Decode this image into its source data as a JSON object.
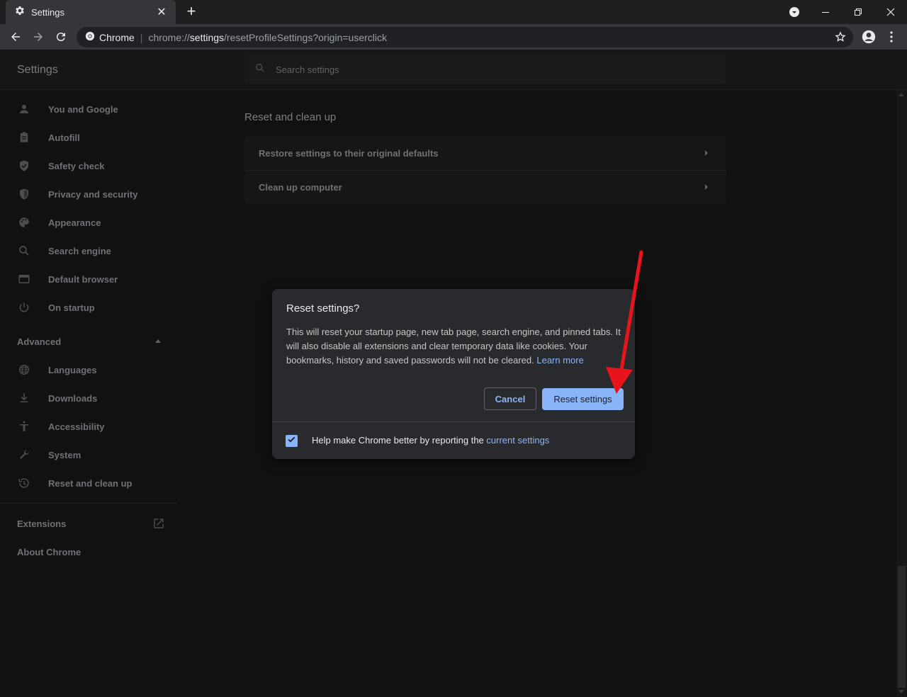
{
  "browser": {
    "tab_title": "Settings",
    "omnibox": {
      "site_label": "Chrome",
      "scheme": "chrome://",
      "host": "settings",
      "path": "/resetProfileSettings?origin=userclick"
    }
  },
  "settings": {
    "title": "Settings",
    "search_placeholder": "Search settings"
  },
  "sidebar": {
    "items": [
      {
        "label": "You and Google",
        "icon": "person-icon"
      },
      {
        "label": "Autofill",
        "icon": "clipboard-icon"
      },
      {
        "label": "Safety check",
        "icon": "shield-check-icon"
      },
      {
        "label": "Privacy and security",
        "icon": "shield-icon"
      },
      {
        "label": "Appearance",
        "icon": "palette-icon"
      },
      {
        "label": "Search engine",
        "icon": "search-icon"
      },
      {
        "label": "Default browser",
        "icon": "browser-window-icon"
      },
      {
        "label": "On startup",
        "icon": "power-icon"
      }
    ],
    "advanced_label": "Advanced",
    "advanced_items": [
      {
        "label": "Languages",
        "icon": "globe-icon"
      },
      {
        "label": "Downloads",
        "icon": "download-icon"
      },
      {
        "label": "Accessibility",
        "icon": "accessibility-icon"
      },
      {
        "label": "System",
        "icon": "wrench-icon"
      },
      {
        "label": "Reset and clean up",
        "icon": "history-icon"
      }
    ],
    "extensions_label": "Extensions",
    "about_label": "About Chrome"
  },
  "main": {
    "section_heading": "Reset and clean up",
    "rows": [
      {
        "label": "Restore settings to their original defaults"
      },
      {
        "label": "Clean up computer"
      }
    ]
  },
  "dialog": {
    "title": "Reset settings?",
    "body": "This will reset your startup page, new tab page, search engine, and pinned tabs. It will also disable all extensions and clear temporary data like cookies. Your bookmarks, history and saved passwords will not be cleared.",
    "learn_more": "Learn more",
    "cancel_label": "Cancel",
    "reset_label": "Reset settings",
    "checkbox_checked": true,
    "checkbox_text": "Help make Chrome better by reporting the",
    "checkbox_link": "current settings"
  },
  "colors": {
    "accent": "#8ab4f8",
    "annotation_arrow": "#e8141c"
  }
}
